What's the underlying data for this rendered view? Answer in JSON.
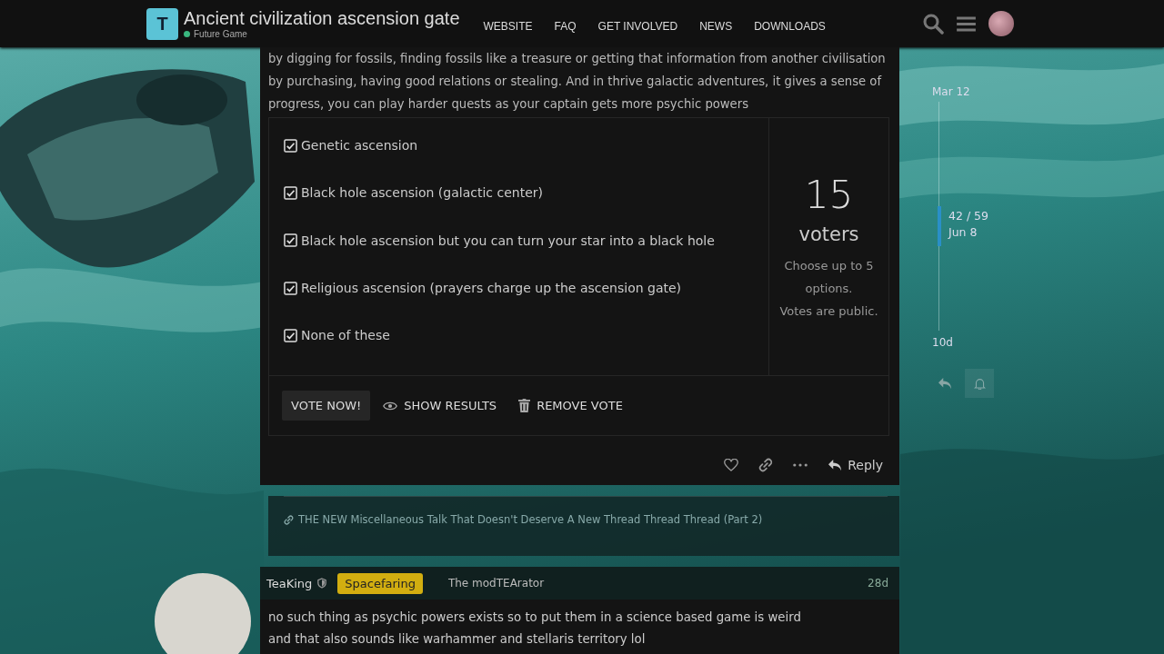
{
  "header": {
    "logo_letter": "T",
    "title": "Ancient civilization ascension gate",
    "category": {
      "name": "Future Game",
      "color": "#3ab77f"
    },
    "nav": [
      {
        "label": "WEBSITE"
      },
      {
        "label": "FAQ"
      },
      {
        "label": "GET INVOLVED"
      },
      {
        "label": "NEWS"
      },
      {
        "label": "DOWNLOADS"
      }
    ]
  },
  "post": {
    "text": "by digging for fossils, finding fossils like a treasure or getting that information from another civilisation by purchasing, having good relations or stealing. And in thrive galactic adventures, it gives a sense of progress, you can play harder quests as your captain gets more psychic powers",
    "poll": {
      "options": [
        {
          "label": "Genetic ascension",
          "checked": true
        },
        {
          "label": "Black hole ascension (galactic center)",
          "checked": true
        },
        {
          "label": "Black hole ascension but you can turn your star into a black hole",
          "checked": true
        },
        {
          "label": "Religious ascension (prayers charge up the ascension gate)",
          "checked": true
        },
        {
          "label": "None of these",
          "checked": true
        }
      ],
      "count": "15",
      "count_label": "voters",
      "limit_text": "Choose up to 5 options.",
      "visibility_text": "Votes are public.",
      "buttons": [
        {
          "label": "VOTE NOW!",
          "kind": "primary"
        },
        {
          "label": "SHOW RESULTS",
          "kind": "results"
        },
        {
          "label": "REMOVE VOTE",
          "kind": "remove"
        }
      ]
    },
    "reply_label": "Reply",
    "linked_topic": "THE NEW Miscellaneous Talk That Doesn't Deserve A New Thread Thread Thread (Part 2)"
  },
  "reply": {
    "username": "TeaKing",
    "badge": "Spacefaring",
    "user_title": "The modTEArator",
    "age": "28d",
    "lines": [
      "no such thing as psychic powers exists so to put them in a science based game is weird",
      "and that also sounds like warhammer and stellaris territory lol"
    ]
  },
  "timeline": {
    "start": "Mar 12",
    "position": "42 / 59",
    "position_date": "Jun 8",
    "end": "10d"
  }
}
